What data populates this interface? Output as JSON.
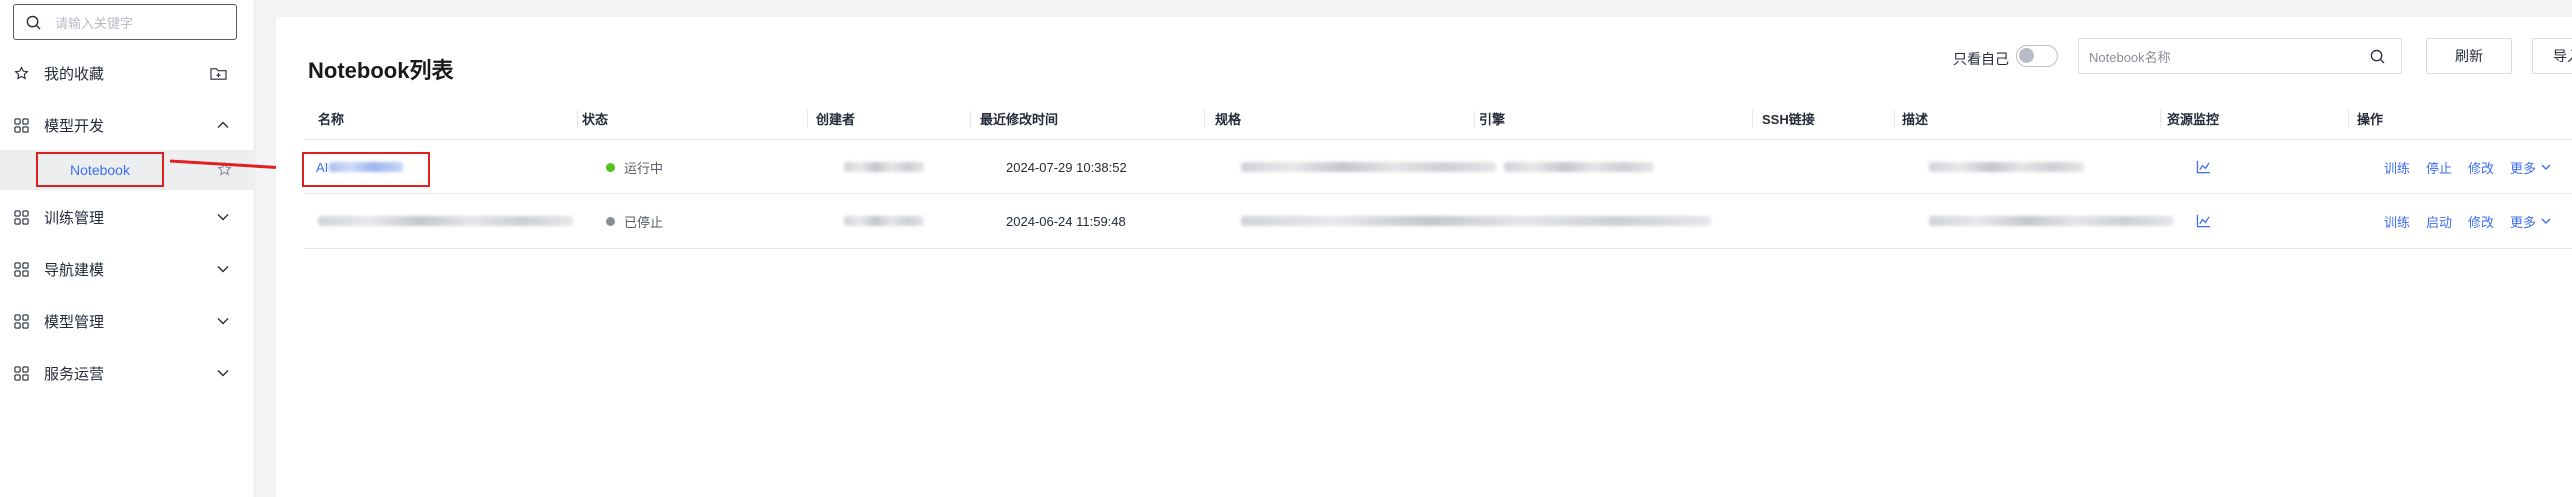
{
  "sidebar": {
    "search_placeholder": "请输入关键字",
    "items": [
      {
        "label": "我的收藏",
        "icon": "star-icon",
        "trailing": "folder-plus-icon"
      },
      {
        "label": "模型开发",
        "icon": "grid-icon",
        "expanded": true
      },
      {
        "label": "训练管理",
        "icon": "grid-icon",
        "expanded": false
      },
      {
        "label": "导航建模",
        "icon": "grid-icon",
        "expanded": false
      },
      {
        "label": "模型管理",
        "icon": "grid-icon",
        "expanded": false
      },
      {
        "label": "服务运营",
        "icon": "grid-icon",
        "expanded": false
      }
    ],
    "active_sub": "Notebook"
  },
  "header": {
    "title": "Notebook列表",
    "only_me_label": "只看自己",
    "only_me_on": false,
    "search_placeholder": "Notebook名称",
    "refresh_label": "刷新",
    "import_label": "导入"
  },
  "table": {
    "columns": [
      "名称",
      "状态",
      "创建者",
      "最近修改时间",
      "规格",
      "引擎",
      "SSH链接",
      "描述",
      "资源监控",
      "操作"
    ],
    "rows": [
      {
        "name_prefix": "AI",
        "status": "运行中",
        "status_color": "#52c41a",
        "modified": "2024-07-29 10:38:52",
        "ops": [
          "训练",
          "停止",
          "修改"
        ],
        "more": "更多"
      },
      {
        "name_prefix": "",
        "status": "已停止",
        "status_color": "#8a8e99",
        "modified": "2024-06-24 11:59:48",
        "ops": [
          "训练",
          "启动",
          "修改"
        ],
        "more": "更多"
      }
    ]
  },
  "colors": {
    "accent": "#3d6ef5",
    "highlight_border": "#e02020"
  }
}
